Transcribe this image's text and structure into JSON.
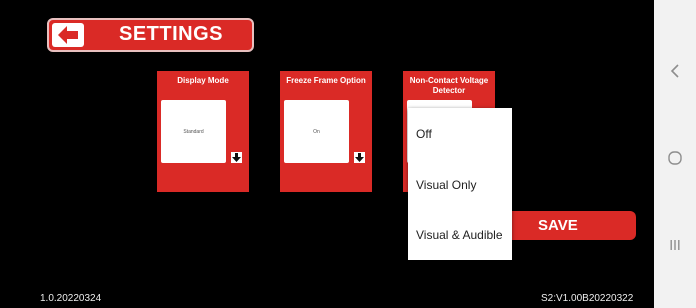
{
  "header": {
    "title": "SETTINGS",
    "back_icon": "back-arrow-icon"
  },
  "cards": [
    {
      "title": "Display Mode",
      "value": "Standard"
    },
    {
      "title": "Freeze Frame Option",
      "value": "On"
    },
    {
      "title": "Non-Contact Voltage Detector",
      "value": ""
    }
  ],
  "dropdown": {
    "options": [
      "Off",
      "Visual Only",
      "Visual & Audible"
    ]
  },
  "save_label": "SAVE",
  "footer": {
    "version_left": "1.0.20220324",
    "version_right": "S2:V1.00B20220322"
  },
  "system_nav": {
    "buttons": [
      "back-icon",
      "home-icon",
      "recents-icon"
    ]
  },
  "colors": {
    "accent": "#da2a26",
    "background": "#000000",
    "panel": "#ffffff",
    "navbar": "#f2f2f2"
  }
}
